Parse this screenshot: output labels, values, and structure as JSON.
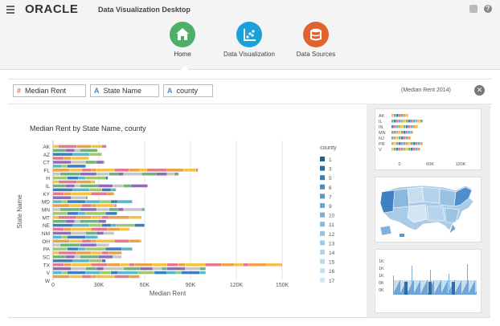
{
  "app": {
    "logo": "ORACLE",
    "title": "Data Visualization Desktop",
    "help_glyph": "?"
  },
  "nav": [
    {
      "label": "Home",
      "color": "#4caf6a",
      "icon": "home-icon"
    },
    {
      "label": "Data Visualization",
      "color": "#1aa1d8",
      "icon": "chart-icon"
    },
    {
      "label": "Data Sources",
      "color": "#e0632f",
      "icon": "database-icon"
    }
  ],
  "filters": {
    "items": [
      {
        "label": "Median Rent",
        "type": "measure",
        "icon_glyph": "#"
      },
      {
        "label": "State Name",
        "type": "attribute",
        "icon_glyph": "A"
      },
      {
        "label": "county",
        "type": "attribute",
        "icon_glyph": "A"
      }
    ],
    "summary": "(Median Rent 2014)",
    "close_glyph": "✕"
  },
  "chart_data": {
    "type": "bar",
    "stacked": true,
    "orientation": "horizontal",
    "title": "Median Rent by State Name, county",
    "xlabel": "Median Rent",
    "ylabel": "State Name",
    "xlim": [
      0,
      150000
    ],
    "xticks": [
      "0",
      "30K",
      "60K",
      "90K",
      "120K",
      "150K"
    ],
    "categories": [
      "AK",
      "AZ",
      "CT",
      "FL",
      "H",
      "IL",
      "KY",
      "MD",
      "MN",
      "MT",
      "NE",
      "NM",
      "OH",
      "PA",
      "SC",
      "TX",
      "V",
      "W"
    ],
    "values": [
      35000,
      32000,
      34000,
      95000,
      36000,
      62000,
      40000,
      52000,
      60000,
      58000,
      60000,
      40000,
      58000,
      52000,
      45000,
      150000,
      100000,
      48000
    ],
    "legend_title": "county",
    "legend": [
      "1",
      "3",
      "5",
      "6",
      "7",
      "9",
      "10",
      "11",
      "12",
      "13",
      "14",
      "15",
      "16",
      "17"
    ],
    "legend_colors": [
      "#1f5f8b",
      "#2a6f9e",
      "#3a7fb0",
      "#4a8cbf",
      "#5a99c8",
      "#6aa6d1",
      "#78b0d8",
      "#86badf",
      "#94c3e4",
      "#a1cbe8",
      "#aed3ec",
      "#bbdaef",
      "#c6e0f2",
      "#d2e7f5"
    ],
    "grid": true
  },
  "side": {
    "mini_bar_labels": [
      "AK",
      "IL",
      "IN",
      "MN",
      "NJ",
      "PR",
      "V"
    ],
    "mini_bar_ticks": [
      "0",
      "60K",
      "120K"
    ],
    "mini_line_ticks": [
      "1K",
      "1K",
      "1K",
      "0K",
      "0K"
    ]
  }
}
